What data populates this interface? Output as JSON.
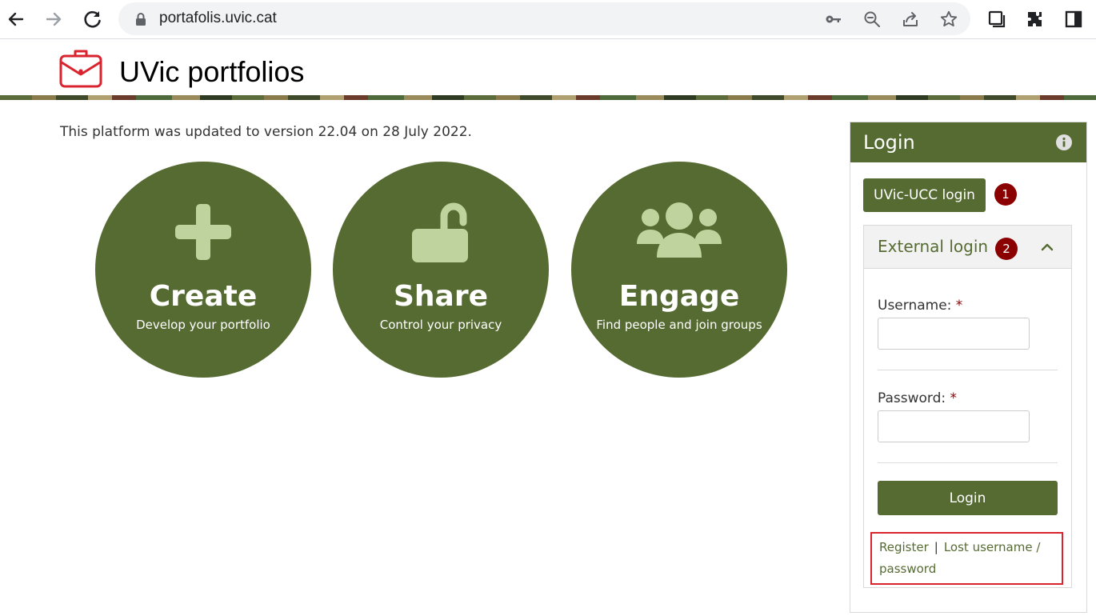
{
  "browser": {
    "url": "portafolis.uvic.cat"
  },
  "site": {
    "title": "UVic portfolios"
  },
  "main": {
    "update_note": "This platform was updated to version 22.04 on 28 July 2022.",
    "circles": [
      {
        "title": "Create",
        "subtitle": "Develop your portfolio",
        "icon": "plus-icon"
      },
      {
        "title": "Share",
        "subtitle": "Control your privacy",
        "icon": "unlock-icon"
      },
      {
        "title": "Engage",
        "subtitle": "Find people and join groups",
        "icon": "users-icon"
      }
    ]
  },
  "login": {
    "title": "Login",
    "ucc_button": "UVic-UCC login",
    "badge1": "1",
    "external_title": "External login",
    "badge2": "2",
    "username_label": "Username:",
    "password_label": "Password:",
    "required_mark": "*",
    "username_value": "",
    "password_value": "",
    "login_button": "Login",
    "register_link": "Register",
    "separator": "|",
    "lost_link": "Lost username / password"
  },
  "colors": {
    "brand_green": "#566b32",
    "icon_light_green": "#bfd39e",
    "badge_red": "#8b0000",
    "highlight_red": "#d9232e"
  }
}
